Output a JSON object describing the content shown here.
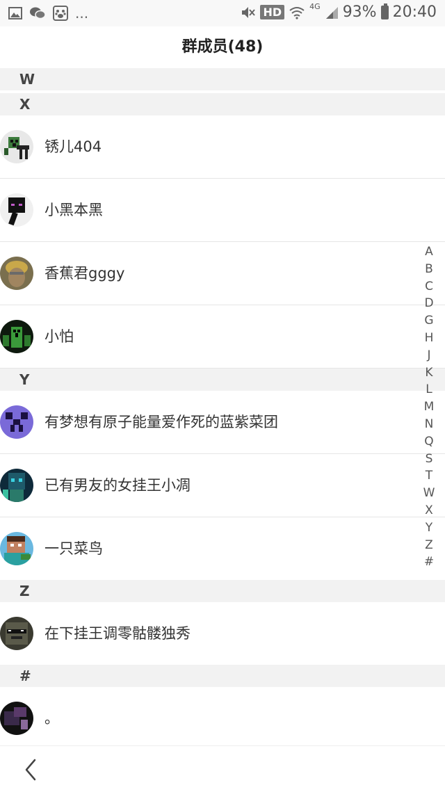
{
  "status_bar": {
    "left_icons": [
      "image-icon",
      "wechat-icon",
      "baidu-paw-icon"
    ],
    "overflow": "...",
    "hd": "HD",
    "network": "4G",
    "battery": "93%",
    "time": "20:40"
  },
  "header": {
    "title": "群成员(48)"
  },
  "sections": [
    {
      "letter": "W",
      "members": []
    },
    {
      "letter": "X",
      "members": [
        {
          "name": "锈儿404",
          "avatar_color": "#3b7a3b"
        },
        {
          "name": "小黑本黑",
          "avatar_color": "#1a1a1a"
        },
        {
          "name": "香蕉君gggy",
          "avatar_color": "#8a7a55"
        },
        {
          "name": "小怕",
          "avatar_color": "#2a4a2a"
        }
      ]
    },
    {
      "letter": "Y",
      "members": [
        {
          "name": "有梦想有原子能量爱作死的蓝紫菜团",
          "avatar_color": "#7a6ad8"
        },
        {
          "name": "已有男友的女挂王小凋",
          "avatar_color": "#1e5a6a"
        },
        {
          "name": "一只菜鸟",
          "avatar_color": "#3a8a4a"
        }
      ]
    },
    {
      "letter": "Z",
      "members": [
        {
          "name": "在下挂王调零骷髅独秀",
          "avatar_color": "#4a4a3a"
        }
      ]
    },
    {
      "letter": "#",
      "members": [
        {
          "name": "。",
          "avatar_color": "#2a1a2a"
        }
      ]
    }
  ],
  "index_letters": [
    "A",
    "B",
    "C",
    "D",
    "G",
    "H",
    "J",
    "K",
    "L",
    "M",
    "N",
    "Q",
    "S",
    "T",
    "W",
    "X",
    "Y",
    "Z",
    "#"
  ],
  "bottom_nav": {
    "back_icon": "chevron-left-icon"
  }
}
